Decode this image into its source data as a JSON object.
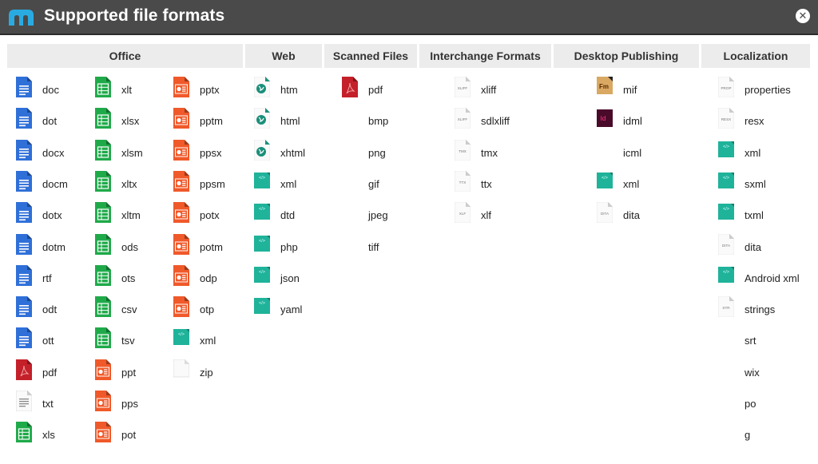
{
  "window": {
    "title": "Supported file formats",
    "logo_color": "#29abe2",
    "close_icon": "close-circle-icon"
  },
  "colors": {
    "word": "#2f6fd8",
    "excel": "#1faa4a",
    "powerpoint": "#f0592a",
    "pdf": "#c4202a",
    "code": "#1fb39a",
    "web": "#1b8f7a",
    "framemaker": "#d9a863",
    "indesign": "#4a0a2a",
    "indesign_text": "#ff3d8a",
    "header_bg": "#ececec",
    "titlebar_bg": "#4a4a4a"
  },
  "sections": [
    {
      "name": "Office",
      "columns": [
        [
          {
            "label": "doc",
            "icon": "word"
          },
          {
            "label": "dot",
            "icon": "word"
          },
          {
            "label": "docx",
            "icon": "word"
          },
          {
            "label": "docm",
            "icon": "word"
          },
          {
            "label": "dotx",
            "icon": "word"
          },
          {
            "label": "dotm",
            "icon": "word"
          },
          {
            "label": "rtf",
            "icon": "word"
          },
          {
            "label": "odt",
            "icon": "word"
          },
          {
            "label": "ott",
            "icon": "word"
          },
          {
            "label": "pdf",
            "icon": "pdf"
          },
          {
            "label": "txt",
            "icon": "text"
          },
          {
            "label": "xls",
            "icon": "excel"
          }
        ],
        [
          {
            "label": "xlt",
            "icon": "excel"
          },
          {
            "label": "xlsx",
            "icon": "excel"
          },
          {
            "label": "xlsm",
            "icon": "excel"
          },
          {
            "label": "xltx",
            "icon": "excel"
          },
          {
            "label": "xltm",
            "icon": "excel"
          },
          {
            "label": "ods",
            "icon": "excel"
          },
          {
            "label": "ots",
            "icon": "excel"
          },
          {
            "label": "csv",
            "icon": "excel"
          },
          {
            "label": "tsv",
            "icon": "excel"
          },
          {
            "label": "ppt",
            "icon": "powerpoint"
          },
          {
            "label": "pps",
            "icon": "powerpoint"
          },
          {
            "label": "pot",
            "icon": "powerpoint"
          }
        ],
        [
          {
            "label": "pptx",
            "icon": "powerpoint"
          },
          {
            "label": "pptm",
            "icon": "powerpoint"
          },
          {
            "label": "ppsx",
            "icon": "powerpoint"
          },
          {
            "label": "ppsm",
            "icon": "powerpoint"
          },
          {
            "label": "potx",
            "icon": "powerpoint"
          },
          {
            "label": "potm",
            "icon": "powerpoint"
          },
          {
            "label": "odp",
            "icon": "powerpoint"
          },
          {
            "label": "otp",
            "icon": "powerpoint"
          },
          {
            "label": "xml",
            "icon": "code"
          },
          {
            "label": "zip",
            "icon": "blank"
          }
        ]
      ]
    },
    {
      "name": "Web",
      "columns": [
        [
          {
            "label": "htm",
            "icon": "web"
          },
          {
            "label": "html",
            "icon": "web"
          },
          {
            "label": "xhtml",
            "icon": "web"
          },
          {
            "label": "xml",
            "icon": "code"
          },
          {
            "label": "dtd",
            "icon": "code"
          },
          {
            "label": "php",
            "icon": "code"
          },
          {
            "label": "json",
            "icon": "code"
          },
          {
            "label": "yaml",
            "icon": "code"
          }
        ]
      ]
    },
    {
      "name": "Scanned Files",
      "columns": [
        [
          {
            "label": "pdf",
            "icon": "pdf"
          },
          {
            "label": "bmp",
            "icon": "none"
          },
          {
            "label": "png",
            "icon": "none"
          },
          {
            "label": "gif",
            "icon": "none"
          },
          {
            "label": "jpeg",
            "icon": "none"
          },
          {
            "label": "tiff",
            "icon": "none"
          }
        ]
      ]
    },
    {
      "name": "Interchange Formats",
      "columns": [
        [
          {
            "label": "xliff",
            "icon": "tag",
            "tag": "XLIFF"
          },
          {
            "label": "sdlxliff",
            "icon": "tag",
            "tag": "XLIFF"
          },
          {
            "label": "tmx",
            "icon": "tag",
            "tag": "TMX"
          },
          {
            "label": "ttx",
            "icon": "tag",
            "tag": "TTX"
          },
          {
            "label": "xlf",
            "icon": "tag",
            "tag": "XLF"
          }
        ]
      ]
    },
    {
      "name": "Desktop Publishing",
      "columns": [
        [
          {
            "label": "mif",
            "icon": "framemaker",
            "tag": "Fm"
          },
          {
            "label": "idml",
            "icon": "indesign",
            "tag": "Id"
          },
          {
            "label": "icml",
            "icon": "none"
          },
          {
            "label": "xml",
            "icon": "code"
          },
          {
            "label": "dita",
            "icon": "tag",
            "tag": "DITA"
          }
        ]
      ]
    },
    {
      "name": "Localization",
      "columns": [
        [
          {
            "label": "properties",
            "icon": "tag",
            "tag": "PROP"
          },
          {
            "label": "resx",
            "icon": "tag",
            "tag": "RESX"
          },
          {
            "label": "xml",
            "icon": "code"
          },
          {
            "label": "sxml",
            "icon": "code"
          },
          {
            "label": "txml",
            "icon": "code"
          },
          {
            "label": "dita",
            "icon": "tag",
            "tag": "DITA"
          },
          {
            "label": "Android xml",
            "icon": "code"
          },
          {
            "label": "strings",
            "icon": "tag",
            "tag": "STR"
          },
          {
            "label": "srt",
            "icon": "none"
          },
          {
            "label": "wix",
            "icon": "none"
          },
          {
            "label": "po",
            "icon": "none"
          },
          {
            "label": "g",
            "icon": "none"
          }
        ]
      ]
    }
  ]
}
